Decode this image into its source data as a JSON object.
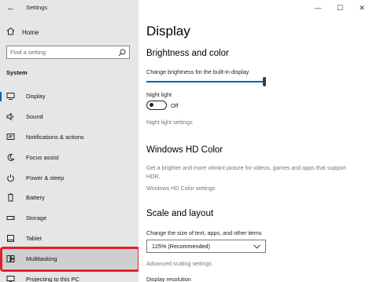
{
  "window": {
    "app_title": "Settings",
    "back_glyph": "←",
    "controls": {
      "minimize": "—",
      "maximize": "☐",
      "close": "✕"
    }
  },
  "sidebar": {
    "home_label": "Home",
    "search": {
      "placeholder": "Find a setting",
      "icon": "search-icon"
    },
    "section_label": "System",
    "items": [
      {
        "label": "Display",
        "icon": "monitor-icon",
        "active": true
      },
      {
        "label": "Sound",
        "icon": "speaker-icon"
      },
      {
        "label": "Notifications & actions",
        "icon": "notification-icon"
      },
      {
        "label": "Focus assist",
        "icon": "moon-icon"
      },
      {
        "label": "Power & sleep",
        "icon": "power-icon"
      },
      {
        "label": "Battery",
        "icon": "battery-icon"
      },
      {
        "label": "Storage",
        "icon": "storage-icon"
      },
      {
        "label": "Tablet",
        "icon": "tablet-icon"
      },
      {
        "label": "Multitasking",
        "icon": "multitasking-icon",
        "highlighted": true
      },
      {
        "label": "Projecting to this PC",
        "icon": "projecting-icon"
      }
    ]
  },
  "main": {
    "page_title": "Display",
    "brightness": {
      "heading": "Brightness and color",
      "slider_label": "Change brightness for the built-in display",
      "slider_value_percent": 100,
      "night_light_label": "Night light",
      "night_light_state": "Off",
      "night_light_settings_link": "Night light settings"
    },
    "hd_color": {
      "heading": "Windows HD Color",
      "description": "Get a brighter and more vibrant picture for videos, games and apps that support HDR.",
      "settings_link": "Windows HD Color settings"
    },
    "scale": {
      "heading": "Scale and layout",
      "label": "Change the size of text, apps, and other items",
      "selected": "125% (Recommended)",
      "advanced_link": "Advanced scaling settings",
      "resolution_label": "Display resolution"
    }
  },
  "colors": {
    "accent": "#0063b1",
    "highlight_ring": "#e0202b",
    "sidebar_bg": "#e6e6e6"
  }
}
